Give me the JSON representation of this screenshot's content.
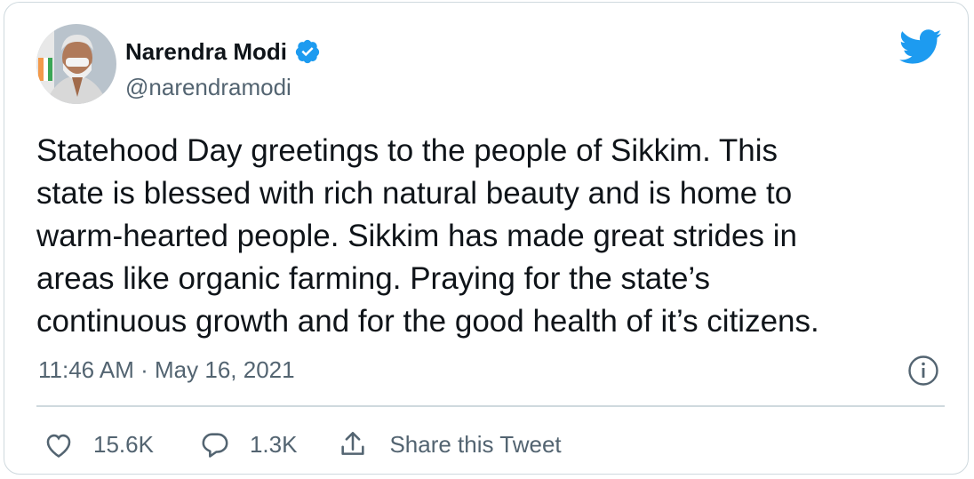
{
  "author": {
    "name": "Narendra Modi",
    "handle": "@narendramodi",
    "verified": true,
    "avatar_icon": "avatar-photo"
  },
  "tweet": {
    "text": "Statehood Day greetings to the people of Sikkim. This\nstate is blessed with rich natural beauty and is home to\nwarm-hearted people. Sikkim has made great strides in\nareas like organic farming. Praying for the state’s\ncontinuous growth and for the good health of it’s citizens.",
    "timestamp": "11:46 AM · May 16, 2021"
  },
  "actions": {
    "like_count": "15.6K",
    "reply_count": "1.3K",
    "share_label": "Share this Tweet"
  },
  "colors": {
    "twitter_blue": "#1d9bf0",
    "text_primary": "#0f1419",
    "text_secondary": "#536471",
    "border": "#cfd9de"
  }
}
